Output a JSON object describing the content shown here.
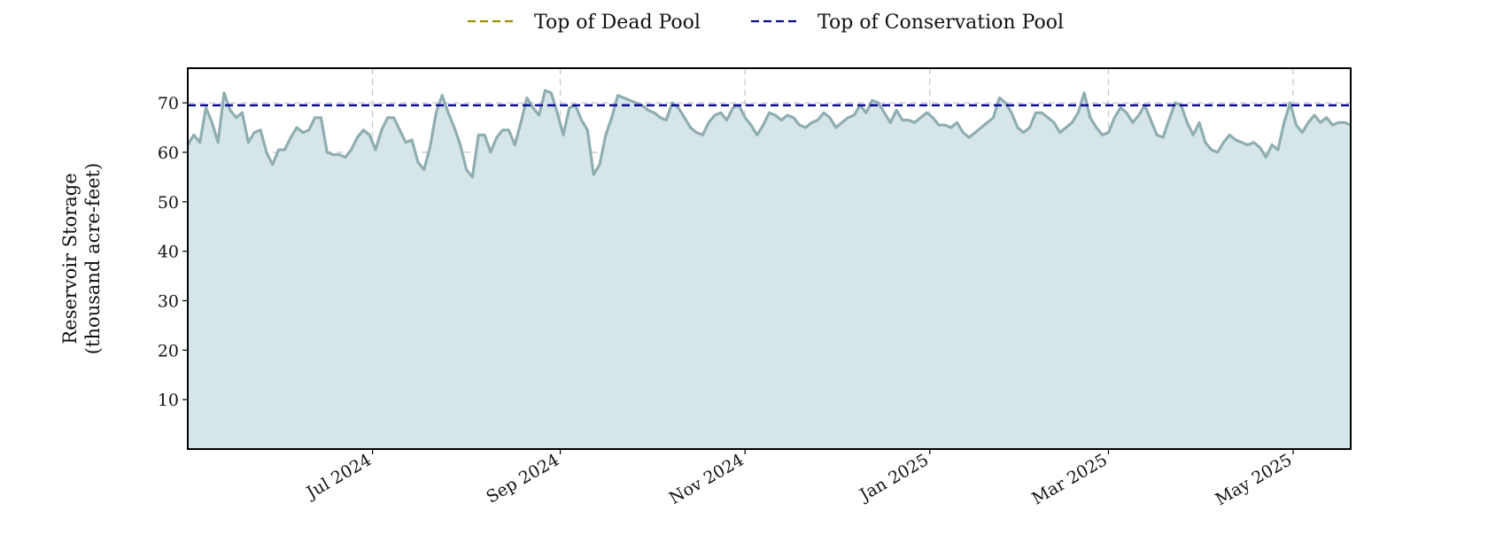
{
  "chart_data": {
    "type": "area",
    "ylabel_lines": [
      "Reservoir Storage",
      "(thousand acre-feet)"
    ],
    "xlim": [
      "2024-05-01",
      "2025-05-20"
    ],
    "ylim": [
      0,
      77
    ],
    "y_ticks": [
      10,
      20,
      30,
      40,
      50,
      60,
      70
    ],
    "x_ticks": [
      {
        "date": "2024-07-01",
        "label": "Jul 2024"
      },
      {
        "date": "2024-09-01",
        "label": "Sep 2024"
      },
      {
        "date": "2024-11-01",
        "label": "Nov 2024"
      },
      {
        "date": "2025-01-01",
        "label": "Jan 2025"
      },
      {
        "date": "2025-03-01",
        "label": "Mar 2025"
      },
      {
        "date": "2025-05-01",
        "label": "May 2025"
      }
    ],
    "grid": true,
    "legend_placement": "top-center",
    "reference_lines": [
      {
        "name": "Top of Dead Pool",
        "color": "#9a8f00",
        "value": null
      },
      {
        "name": "Top of Conservation Pool",
        "color": "#0a0a8c",
        "value": 69.5
      }
    ],
    "series": [
      {
        "color": "#8faeb2",
        "fill": "#d6e6e8",
        "points": [
          [
            "2024-05-01",
            61.5
          ],
          [
            "2024-05-03",
            63.5
          ],
          [
            "2024-05-05",
            62
          ],
          [
            "2024-05-07",
            69
          ],
          [
            "2024-05-09",
            66
          ],
          [
            "2024-05-11",
            62
          ],
          [
            "2024-05-13",
            72
          ],
          [
            "2024-05-15",
            68.5
          ],
          [
            "2024-05-17",
            67
          ],
          [
            "2024-05-19",
            68
          ],
          [
            "2024-05-21",
            62
          ],
          [
            "2024-05-23",
            64
          ],
          [
            "2024-05-25",
            64.5
          ],
          [
            "2024-05-27",
            60
          ],
          [
            "2024-05-29",
            57.5
          ],
          [
            "2024-05-31",
            60.5
          ],
          [
            "2024-06-02",
            60.5
          ],
          [
            "2024-06-04",
            63
          ],
          [
            "2024-06-06",
            65
          ],
          [
            "2024-06-08",
            64
          ],
          [
            "2024-06-10",
            64.5
          ],
          [
            "2024-06-12",
            67
          ],
          [
            "2024-06-14",
            67
          ],
          [
            "2024-06-16",
            60
          ],
          [
            "2024-06-18",
            59.5
          ],
          [
            "2024-06-20",
            59.5
          ],
          [
            "2024-06-22",
            59
          ],
          [
            "2024-06-24",
            60.5
          ],
          [
            "2024-06-26",
            63
          ],
          [
            "2024-06-28",
            64.5
          ],
          [
            "2024-06-30",
            63.5
          ],
          [
            "2024-07-02",
            60.5
          ],
          [
            "2024-07-04",
            64.5
          ],
          [
            "2024-07-06",
            67
          ],
          [
            "2024-07-08",
            67
          ],
          [
            "2024-07-10",
            64.5
          ],
          [
            "2024-07-12",
            62
          ],
          [
            "2024-07-14",
            62.5
          ],
          [
            "2024-07-16",
            58
          ],
          [
            "2024-07-18",
            56.5
          ],
          [
            "2024-07-20",
            61
          ],
          [
            "2024-07-22",
            68
          ],
          [
            "2024-07-24",
            71.5
          ],
          [
            "2024-07-26",
            68
          ],
          [
            "2024-07-28",
            65
          ],
          [
            "2024-07-30",
            61.5
          ],
          [
            "2024-08-01",
            56.5
          ],
          [
            "2024-08-03",
            55
          ],
          [
            "2024-08-05",
            63.5
          ],
          [
            "2024-08-07",
            63.5
          ],
          [
            "2024-08-09",
            60
          ],
          [
            "2024-08-11",
            63
          ],
          [
            "2024-08-13",
            64.5
          ],
          [
            "2024-08-15",
            64.5
          ],
          [
            "2024-08-17",
            61.5
          ],
          [
            "2024-08-19",
            66
          ],
          [
            "2024-08-21",
            71
          ],
          [
            "2024-08-23",
            69
          ],
          [
            "2024-08-25",
            67.5
          ],
          [
            "2024-08-27",
            72.5
          ],
          [
            "2024-08-29",
            72
          ],
          [
            "2024-08-31",
            68
          ],
          [
            "2024-09-02",
            63.5
          ],
          [
            "2024-09-04",
            69
          ],
          [
            "2024-09-06",
            69.5
          ],
          [
            "2024-09-08",
            66.5
          ],
          [
            "2024-09-10",
            64.5
          ],
          [
            "2024-09-12",
            55.5
          ],
          [
            "2024-09-14",
            57.5
          ],
          [
            "2024-09-16",
            63.5
          ],
          [
            "2024-09-18",
            67
          ],
          [
            "2024-09-20",
            71.5
          ],
          [
            "2024-09-22",
            71
          ],
          [
            "2024-09-24",
            70.5
          ],
          [
            "2024-09-26",
            70
          ],
          [
            "2024-09-28",
            69.5
          ],
          [
            "2024-09-30",
            68.5
          ],
          [
            "2024-10-02",
            68
          ],
          [
            "2024-10-04",
            67
          ],
          [
            "2024-10-06",
            66.5
          ],
          [
            "2024-10-08",
            70
          ],
          [
            "2024-10-10",
            69
          ],
          [
            "2024-10-12",
            67
          ],
          [
            "2024-10-14",
            65
          ],
          [
            "2024-10-16",
            64
          ],
          [
            "2024-10-18",
            63.5
          ],
          [
            "2024-10-20",
            66
          ],
          [
            "2024-10-22",
            67.5
          ],
          [
            "2024-10-24",
            68
          ],
          [
            "2024-10-26",
            66.5
          ],
          [
            "2024-10-28",
            69
          ],
          [
            "2024-10-30",
            69.5
          ],
          [
            "2024-11-01",
            67
          ],
          [
            "2024-11-03",
            65.5
          ],
          [
            "2024-11-05",
            63.5
          ],
          [
            "2024-11-07",
            65.5
          ],
          [
            "2024-11-09",
            68
          ],
          [
            "2024-11-11",
            67.5
          ],
          [
            "2024-11-13",
            66.5
          ],
          [
            "2024-11-15",
            67.5
          ],
          [
            "2024-11-17",
            67
          ],
          [
            "2024-11-19",
            65.5
          ],
          [
            "2024-11-21",
            65
          ],
          [
            "2024-11-23",
            66
          ],
          [
            "2024-11-25",
            66.5
          ],
          [
            "2024-11-27",
            68
          ],
          [
            "2024-11-29",
            67
          ],
          [
            "2024-12-01",
            65
          ],
          [
            "2024-12-03",
            66
          ],
          [
            "2024-12-05",
            67
          ],
          [
            "2024-12-07",
            67.5
          ],
          [
            "2024-12-09",
            69.5
          ],
          [
            "2024-12-11",
            68
          ],
          [
            "2024-12-13",
            70.5
          ],
          [
            "2024-12-15",
            70
          ],
          [
            "2024-12-17",
            68
          ],
          [
            "2024-12-19",
            66
          ],
          [
            "2024-12-21",
            68.5
          ],
          [
            "2024-12-23",
            66.5
          ],
          [
            "2024-12-25",
            66.5
          ],
          [
            "2024-12-27",
            66
          ],
          [
            "2024-12-29",
            67
          ],
          [
            "2024-12-31",
            68
          ],
          [
            "2025-01-02",
            67
          ],
          [
            "2025-01-04",
            65.5
          ],
          [
            "2025-01-06",
            65.5
          ],
          [
            "2025-01-08",
            65
          ],
          [
            "2025-01-10",
            66
          ],
          [
            "2025-01-12",
            64
          ],
          [
            "2025-01-14",
            63
          ],
          [
            "2025-01-16",
            64
          ],
          [
            "2025-01-18",
            65
          ],
          [
            "2025-01-20",
            66
          ],
          [
            "2025-01-22",
            67
          ],
          [
            "2025-01-24",
            71
          ],
          [
            "2025-01-26",
            70
          ],
          [
            "2025-01-28",
            68
          ],
          [
            "2025-01-30",
            65
          ],
          [
            "2025-02-01",
            64
          ],
          [
            "2025-02-03",
            65
          ],
          [
            "2025-02-05",
            68
          ],
          [
            "2025-02-07",
            68
          ],
          [
            "2025-02-09",
            67
          ],
          [
            "2025-02-11",
            66
          ],
          [
            "2025-02-13",
            64
          ],
          [
            "2025-02-15",
            65
          ],
          [
            "2025-02-17",
            66
          ],
          [
            "2025-02-19",
            68
          ],
          [
            "2025-02-21",
            72
          ],
          [
            "2025-02-23",
            67
          ],
          [
            "2025-02-25",
            65
          ],
          [
            "2025-02-27",
            63.5
          ],
          [
            "2025-03-01",
            64
          ],
          [
            "2025-03-03",
            67
          ],
          [
            "2025-03-05",
            69
          ],
          [
            "2025-03-07",
            68
          ],
          [
            "2025-03-09",
            66
          ],
          [
            "2025-03-11",
            67.5
          ],
          [
            "2025-03-13",
            69.5
          ],
          [
            "2025-03-15",
            66.5
          ],
          [
            "2025-03-17",
            63.5
          ],
          [
            "2025-03-19",
            63
          ],
          [
            "2025-03-21",
            66.5
          ],
          [
            "2025-03-23",
            70
          ],
          [
            "2025-03-25",
            69.5
          ],
          [
            "2025-03-27",
            66
          ],
          [
            "2025-03-29",
            63.5
          ],
          [
            "2025-03-31",
            66
          ],
          [
            "2025-04-02",
            62
          ],
          [
            "2025-04-04",
            60.5
          ],
          [
            "2025-04-06",
            60
          ],
          [
            "2025-04-08",
            62
          ],
          [
            "2025-04-10",
            63.5
          ],
          [
            "2025-04-12",
            62.5
          ],
          [
            "2025-04-14",
            62
          ],
          [
            "2025-04-16",
            61.5
          ],
          [
            "2025-04-18",
            62
          ],
          [
            "2025-04-20",
            61
          ],
          [
            "2025-04-22",
            59
          ],
          [
            "2025-04-24",
            61.5
          ],
          [
            "2025-04-26",
            60.5
          ],
          [
            "2025-04-28",
            66
          ],
          [
            "2025-04-30",
            70
          ],
          [
            "2025-05-02",
            65.5
          ],
          [
            "2025-05-04",
            64
          ],
          [
            "2025-05-06",
            66
          ],
          [
            "2025-05-08",
            67.5
          ],
          [
            "2025-05-10",
            66
          ],
          [
            "2025-05-12",
            67
          ],
          [
            "2025-05-14",
            65.5
          ],
          [
            "2025-05-16",
            66
          ],
          [
            "2025-05-18",
            66
          ],
          [
            "2025-05-20",
            65.5
          ]
        ]
      }
    ]
  }
}
